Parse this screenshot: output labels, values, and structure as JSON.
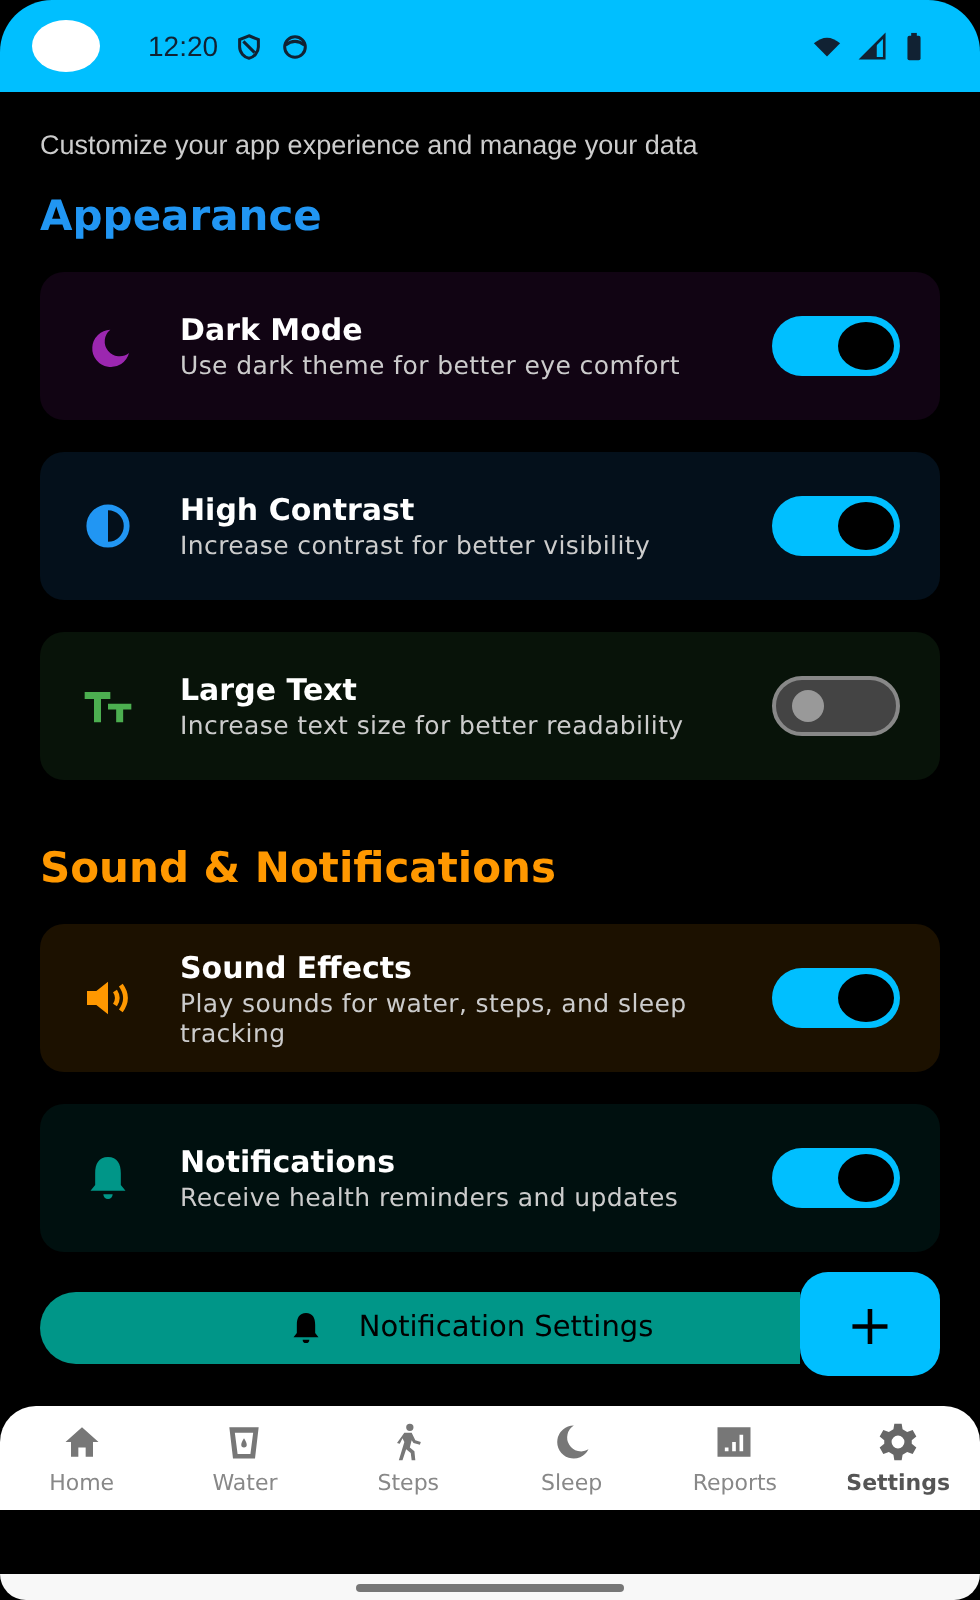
{
  "status_bar": {
    "time": "12:20"
  },
  "subtitle": "Customize your app experience and manage your data",
  "sections": [
    {
      "title": "Appearance",
      "color": "#2196f3",
      "items": [
        {
          "kind": "moon",
          "title": "Dark Mode",
          "description": "Use dark theme for better eye comfort",
          "color": "#9c27b0",
          "on": true
        },
        {
          "kind": "contrast",
          "title": "High Contrast",
          "description": "Increase contrast for better visibility",
          "color": "#2196f3",
          "on": true
        },
        {
          "kind": "text-size",
          "title": "Large Text",
          "description": "Increase text size for better readability",
          "color": "#4caf50",
          "on": false
        }
      ]
    },
    {
      "title": "Sound & Notifications",
      "color": "#ff9800",
      "items": [
        {
          "kind": "speaker",
          "title": "Sound Effects",
          "description": "Play sounds for water, steps, and sleep tracking",
          "color": "#ff9800",
          "on": true
        },
        {
          "kind": "bell",
          "title": "Notifications",
          "description": "Receive health reminders and updates",
          "color": "#009688",
          "on": true
        }
      ]
    }
  ],
  "notification_button": {
    "label": "Notification Settings"
  },
  "fab": {
    "label": "+"
  },
  "tabs": [
    {
      "kind": "home",
      "label": "Home",
      "selected": false
    },
    {
      "kind": "water",
      "label": "Water",
      "selected": false
    },
    {
      "kind": "steps",
      "label": "Steps",
      "selected": false
    },
    {
      "kind": "sleep",
      "label": "Sleep",
      "selected": false
    },
    {
      "kind": "reports",
      "label": "Reports",
      "selected": false
    },
    {
      "kind": "settings",
      "label": "Settings",
      "selected": true
    }
  ]
}
